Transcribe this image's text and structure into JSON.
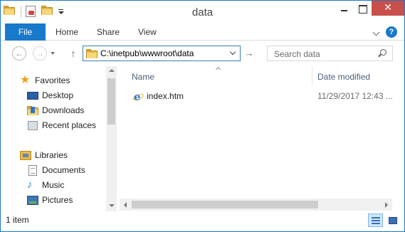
{
  "window": {
    "title": "data",
    "close_glyph": "✕"
  },
  "ribbon": {
    "tabs": [
      {
        "label": "File"
      },
      {
        "label": "Home"
      },
      {
        "label": "Share"
      },
      {
        "label": "View"
      }
    ],
    "help_glyph": "?"
  },
  "navigation": {
    "back_glyph": "←",
    "forward_glyph": "→",
    "up_glyph": "↑",
    "address": "C:\\inetpub\\wwwroot\\data",
    "go_glyph": "→",
    "search_placeholder": "Search data"
  },
  "sidebar": {
    "items": [
      {
        "label": "Favorites",
        "icon": "star-icon"
      },
      {
        "label": "Desktop",
        "icon": "desktop-icon"
      },
      {
        "label": "Downloads",
        "icon": "downloads-icon"
      },
      {
        "label": "Recent places",
        "icon": "recent-places-icon"
      },
      {
        "label": "Libraries",
        "icon": "libraries-icon"
      },
      {
        "label": "Documents",
        "icon": "documents-icon"
      },
      {
        "label": "Music",
        "icon": "music-icon"
      },
      {
        "label": "Pictures",
        "icon": "pictures-icon"
      }
    ],
    "star_glyph": "★",
    "music_glyph": "♪"
  },
  "content": {
    "columns": [
      {
        "label": "Name"
      },
      {
        "label": "Date modified"
      }
    ],
    "files": [
      {
        "name": "index.htm",
        "date_modified": "11/29/2017 12:43 ...",
        "icon": "ie-document-icon"
      }
    ]
  },
  "status": {
    "item_count": "1 item"
  },
  "colors": {
    "accent": "#1979ca",
    "close_button": "#c7504b",
    "column_header_text": "#4c607a"
  }
}
